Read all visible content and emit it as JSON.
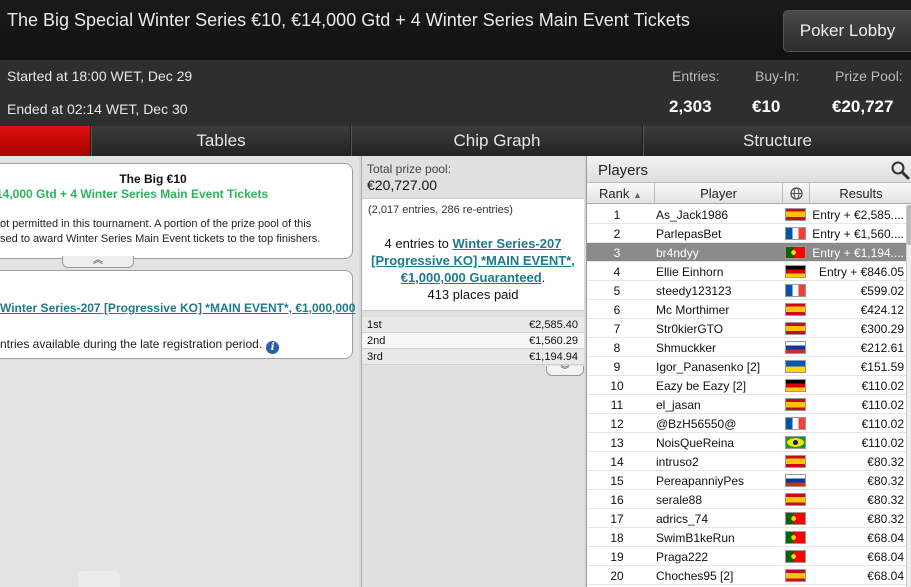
{
  "window": {
    "title": "The Big Special Winter Series €10, €14,000 Gtd + 4 Winter Series Main Event Tickets",
    "lobby_button": "Poker Lobby"
  },
  "info": {
    "started": "Started at 18:00 WET, Dec 29",
    "ended": "Ended at 02:14 WET, Dec 30",
    "entries_label": "Entries:",
    "entries_value": "2,303",
    "buyin_label": "Buy-In:",
    "buyin_value": "€10",
    "prize_label": "Prize Pool:",
    "prize_value": "€20,727"
  },
  "tabs": [
    {
      "label": "",
      "active": true
    },
    {
      "label": "Tables"
    },
    {
      "label": "Chip Graph"
    },
    {
      "label": "Structure"
    }
  ],
  "left": {
    "tourney_name": "The Big €10",
    "tourney_sub": "14,000 Gtd + 4 Winter Series Main Event Tickets",
    "desc_line1": "ot permitted in this tournament. A portion of the prize pool of this",
    "desc_line2": "sed to award Winter Series Main Event tickets to the top finishers.",
    "expand_glyph": "︽",
    "main_event_link": "Winter Series-207 [Progressive KO] *MAIN EVENT*, €1,000,000",
    "late_reg": "ntries available during the late registration period.",
    "info_glyph": "i"
  },
  "middle": {
    "prize_label": "Total prize pool:",
    "prize_total": "€20,727.00",
    "entries_note": "(2,017 entries, 286 re-entries)",
    "tickets_prefix": "4 entries to ",
    "tickets_link": "Winter Series-207 [Progressive KO] *MAIN EVENT*, €1,000,000 Guaranteed",
    "tickets_suffix": ".",
    "places_paid": "413 places paid",
    "payouts": [
      {
        "place": "1st",
        "amount": "€2,585.40"
      },
      {
        "place": "2nd",
        "amount": "€1,560.29"
      },
      {
        "place": "3rd",
        "amount": "€1,194.94"
      }
    ],
    "expand_glyph": "︾"
  },
  "players": {
    "title": "Players",
    "search_icon": "search-icon",
    "col_rank": "Rank",
    "col_player": "Player",
    "col_results": "Results",
    "rows": [
      {
        "rank": "1",
        "player": "As_Jack1986",
        "flag": "spain",
        "result": "Entry + €2,585...."
      },
      {
        "rank": "2",
        "player": "ParlepasBet",
        "flag": "france",
        "result": "Entry + €1,560...."
      },
      {
        "rank": "3",
        "player": "br4ndyy",
        "flag": "portugal",
        "result": "Entry + €1,194....",
        "selected": true
      },
      {
        "rank": "4",
        "player": "Ellie Einhorn",
        "flag": "germany",
        "result": "Entry + €846.05"
      },
      {
        "rank": "5",
        "player": "steedy123123",
        "flag": "france",
        "result": "€599.02"
      },
      {
        "rank": "6",
        "player": "Mc Morthimer",
        "flag": "spain",
        "result": "€424.12"
      },
      {
        "rank": "7",
        "player": "Str0kierGTO",
        "flag": "spain",
        "result": "€300.29"
      },
      {
        "rank": "8",
        "player": "Shmuckker",
        "flag": "russia",
        "result": "€212.61"
      },
      {
        "rank": "9",
        "player": "Igor_Panasenko [2]",
        "flag": "ukraine",
        "result": "€151.59"
      },
      {
        "rank": "10",
        "player": "Eazy be Eazy [2]",
        "flag": "germany",
        "result": "€110.02"
      },
      {
        "rank": "11",
        "player": "el_jasan",
        "flag": "spain",
        "result": "€110.02"
      },
      {
        "rank": "12",
        "player": "@BzH56550@",
        "flag": "france",
        "result": "€110.02"
      },
      {
        "rank": "13",
        "player": "NoisQueReina",
        "flag": "brazil",
        "result": "€110.02"
      },
      {
        "rank": "14",
        "player": "intruso2",
        "flag": "spain",
        "result": "€80.32"
      },
      {
        "rank": "15",
        "player": "PereapanniyPes",
        "flag": "russia",
        "result": "€80.32"
      },
      {
        "rank": "16",
        "player": "serale88",
        "flag": "spain",
        "result": "€80.32"
      },
      {
        "rank": "17",
        "player": "adrics_74",
        "flag": "portugal",
        "result": "€80.32"
      },
      {
        "rank": "18",
        "player": "SwimB1keRun",
        "flag": "portugal",
        "result": "€68.04"
      },
      {
        "rank": "19",
        "player": "Praga222",
        "flag": "portugal",
        "result": "€68.04"
      },
      {
        "rank": "20",
        "player": "Choches95 [2]",
        "flag": "spain",
        "result": "€68.04"
      }
    ]
  }
}
